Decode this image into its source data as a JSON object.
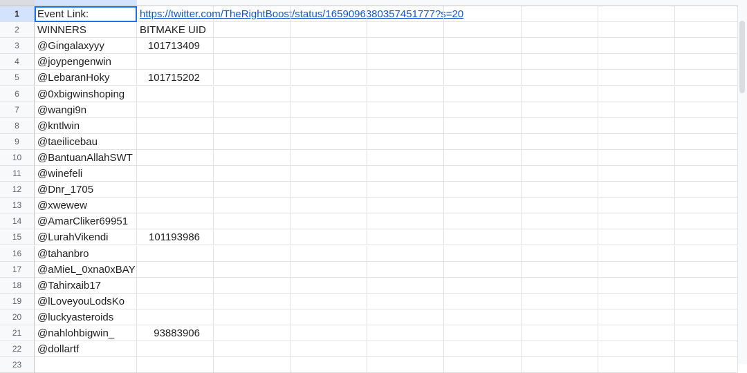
{
  "sheet": {
    "rows": [
      {
        "num": "1",
        "a": "Event Link:",
        "b": "https://twitter.com/TheRightBoost/status/1659096380357451777?s=20"
      },
      {
        "num": "2",
        "a": "WINNERS",
        "b": "BITMAKE UID"
      },
      {
        "num": "3",
        "a": "@Gingalaxyyy",
        "b": "101713409"
      },
      {
        "num": "4",
        "a": "@joypengenwin",
        "b": ""
      },
      {
        "num": "5",
        "a": "@LebaranHoky",
        "b": "101715202"
      },
      {
        "num": "6",
        "a": "@0xbigwinshoping",
        "b": ""
      },
      {
        "num": "7",
        "a": "@wangi9n",
        "b": ""
      },
      {
        "num": "8",
        "a": "@kntlwin",
        "b": ""
      },
      {
        "num": "9",
        "a": "@taeilicebau",
        "b": ""
      },
      {
        "num": "10",
        "a": "@BantuanAllahSWT",
        "b": ""
      },
      {
        "num": "11",
        "a": "@winefeli",
        "b": ""
      },
      {
        "num": "12",
        "a": "@Dnr_1705",
        "b": ""
      },
      {
        "num": "13",
        "a": "@xwewew",
        "b": ""
      },
      {
        "num": "14",
        "a": "@AmarCliker69951",
        "b": ""
      },
      {
        "num": "15",
        "a": "@LurahVikendi",
        "b": "101193986"
      },
      {
        "num": "16",
        "a": "@tahanbro",
        "b": ""
      },
      {
        "num": "17",
        "a": "@aMieL_0xna0xBAY",
        "b": ""
      },
      {
        "num": "18",
        "a": "@Tahirxaib17",
        "b": ""
      },
      {
        "num": "19",
        "a": "@lLoveyouLodsKo",
        "b": ""
      },
      {
        "num": "20",
        "a": "@luckyasteroids",
        "b": ""
      },
      {
        "num": "21",
        "a": "@nahlohbigwin_",
        "b": "93883906"
      },
      {
        "num": "22",
        "a": "@dollartf",
        "b": ""
      },
      {
        "num": "23",
        "a": "",
        "b": ""
      }
    ]
  },
  "colors": {
    "link": "#1155cc",
    "selection": "#1a73e8",
    "header_bg": "#f8f9fa"
  }
}
